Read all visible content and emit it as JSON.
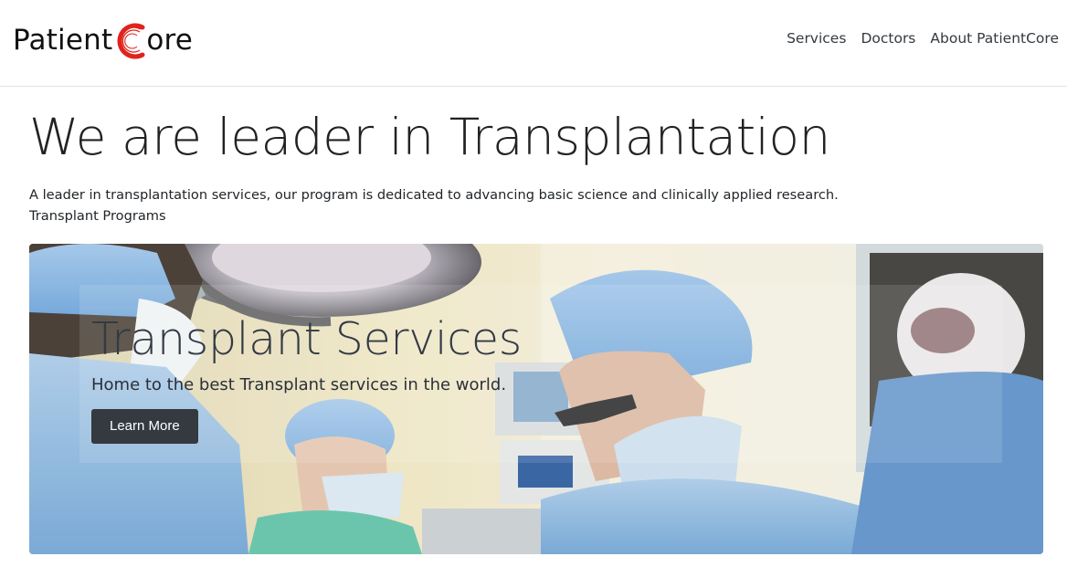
{
  "brand": {
    "name_part1": "Patient",
    "name_part2": "ore",
    "accent_color": "#e0231c",
    "icon": "patientcore-c-logo"
  },
  "nav": {
    "items": [
      {
        "label": "Services"
      },
      {
        "label": "Doctors"
      },
      {
        "label": "About PatientCore"
      }
    ]
  },
  "hero": {
    "title": "We are leader in Transplantation",
    "lead": "A leader in transplantation services, our program is dedicated to advancing basic science and clinically applied research.",
    "programs_label": "Transplant Programs"
  },
  "banner": {
    "image": "surgeons-in-operating-room-photo",
    "title": "Transplant Services",
    "subtitle": "Home to the best Transplant services in the world.",
    "button_label": "Learn More"
  }
}
